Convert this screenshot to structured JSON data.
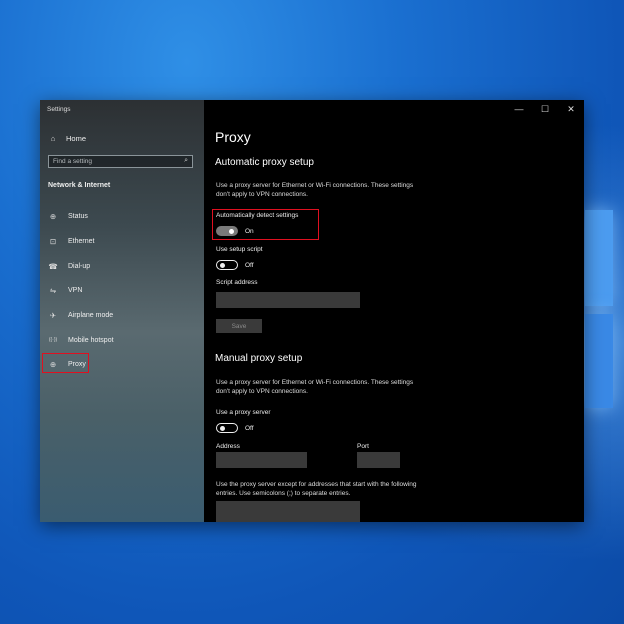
{
  "window": {
    "title": "Settings",
    "controls": {
      "minimize": "—",
      "maximize": "☐",
      "close": "✕"
    }
  },
  "sidebar": {
    "home_label": "Home",
    "search": {
      "placeholder": "Find a setting"
    },
    "section_header": "Network & Internet",
    "items": [
      {
        "label": "Status",
        "icon": "status-icon",
        "glyph": "⊕"
      },
      {
        "label": "Ethernet",
        "icon": "ethernet-icon",
        "glyph": "⊡"
      },
      {
        "label": "Dial-up",
        "icon": "dialup-icon",
        "glyph": "☎"
      },
      {
        "label": "VPN",
        "icon": "vpn-icon",
        "glyph": "⇋"
      },
      {
        "label": "Airplane mode",
        "icon": "airplane-icon",
        "glyph": "✈"
      },
      {
        "label": "Mobile hotspot",
        "icon": "hotspot-icon",
        "glyph": "((·))"
      },
      {
        "label": "Proxy",
        "icon": "globe-icon",
        "glyph": "⊕",
        "selected": true
      }
    ]
  },
  "main": {
    "page_title": "Proxy",
    "automatic": {
      "heading": "Automatic proxy setup",
      "description_line1": "Use a proxy server for Ethernet or Wi-Fi connections. These settings",
      "description_line2": "don't apply to VPN connections.",
      "auto_detect_label": "Automatically detect settings",
      "auto_detect_state": "On",
      "setup_script_label": "Use setup script",
      "setup_script_state": "Off",
      "script_address_label": "Script address",
      "script_address_value": "",
      "save_label": "Save"
    },
    "manual": {
      "heading": "Manual proxy setup",
      "description_line1": "Use a proxy server for Ethernet or Wi-Fi connections. These settings",
      "description_line2": "don't apply to VPN connections.",
      "use_proxy_label": "Use a proxy server",
      "use_proxy_state": "Off",
      "address_label": "Address",
      "address_value": "",
      "port_label": "Port",
      "port_value": "",
      "exceptions_line1": "Use the proxy server except for addresses that start with the following",
      "exceptions_line2": "entries. Use semicolons (;) to separate entries.",
      "exceptions_value": ""
    }
  },
  "colors": {
    "highlight": "#e01020",
    "accent_blue": "#1a6fd0"
  }
}
